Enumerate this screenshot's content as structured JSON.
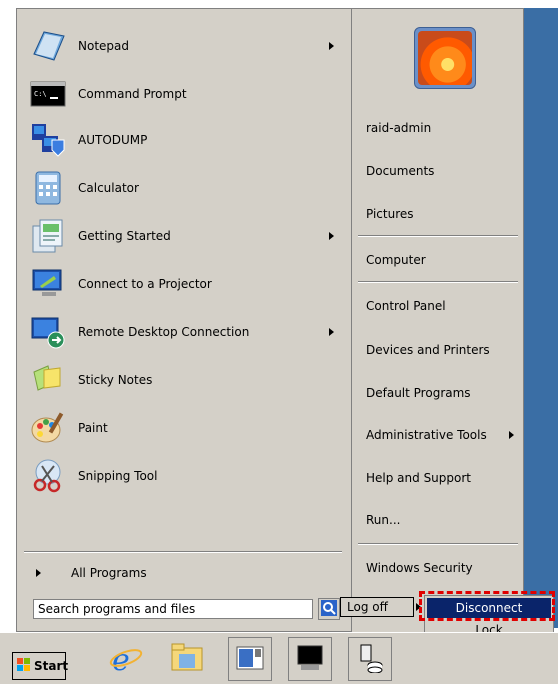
{
  "programs": [
    {
      "label": "Notepad",
      "icon": "notepad-icon",
      "has_submenu": true
    },
    {
      "label": "Command Prompt",
      "icon": "command-prompt-icon",
      "has_submenu": false
    },
    {
      "label": "AUTODUMP",
      "icon": "autodump-icon",
      "has_submenu": false
    },
    {
      "label": "Calculator",
      "icon": "calculator-icon",
      "has_submenu": false
    },
    {
      "label": "Getting Started",
      "icon": "getting-started-icon",
      "has_submenu": true
    },
    {
      "label": "Connect to a Projector",
      "icon": "projector-icon",
      "has_submenu": false
    },
    {
      "label": "Remote Desktop Connection",
      "icon": "remote-desktop-icon",
      "has_submenu": true
    },
    {
      "label": "Sticky Notes",
      "icon": "sticky-notes-icon",
      "has_submenu": false
    },
    {
      "label": "Paint",
      "icon": "paint-icon",
      "has_submenu": false
    },
    {
      "label": "Snipping Tool",
      "icon": "snipping-tool-icon",
      "has_submenu": false
    }
  ],
  "all_programs_label": "All Programs",
  "search": {
    "placeholder": "Search programs and files"
  },
  "right_items": [
    {
      "label": "raid-admin",
      "has_submenu": false
    },
    {
      "label": "Documents",
      "has_submenu": false
    },
    {
      "label": "Pictures",
      "has_submenu": false
    },
    {
      "label": "Computer",
      "has_submenu": false
    },
    {
      "label": "Control Panel",
      "has_submenu": false
    },
    {
      "label": "Devices and Printers",
      "has_submenu": false
    },
    {
      "label": "Default Programs",
      "has_submenu": false
    },
    {
      "label": "Administrative Tools",
      "has_submenu": true
    },
    {
      "label": "Help and Support",
      "has_submenu": false
    },
    {
      "label": "Run...",
      "has_submenu": false
    },
    {
      "label": "Windows Security",
      "has_submenu": false
    }
  ],
  "logoff_label": "Log off",
  "submenu": {
    "disconnect": "Disconnect",
    "lock": "Lock"
  },
  "taskbar": {
    "start_label": "Start"
  },
  "colors": {
    "menu_bg": "#d4d0c8",
    "highlight": "#0a246a",
    "annotation": "#e00000",
    "desktop": "#3a6ea5"
  }
}
